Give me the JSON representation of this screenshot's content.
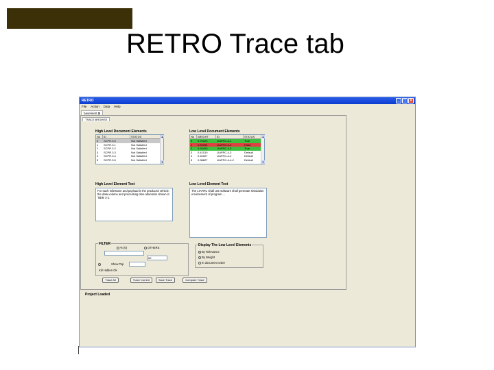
{
  "slide": {
    "title": "RETRO Trace tab",
    "accent_color": "#3b3008"
  },
  "window": {
    "title": "RETRO",
    "controls": [
      "_",
      "□",
      "X"
    ],
    "menu": [
      "File",
      "Action",
      "Data",
      "Help"
    ],
    "file_tab": "baseline0 ⊠",
    "inner_tab": "TRACE  BROWSE"
  },
  "high_level": {
    "title": "High Level Document Elements",
    "columns": [
      "No",
      "ID",
      "STATUS"
    ],
    "rows": [
      {
        "no": "0",
        "id": "SCPR.3.0",
        "status": "Not Satisfied"
      },
      {
        "no": "1",
        "id": "SCPR.3.1",
        "status": "Not Satisfied"
      },
      {
        "no": "2",
        "id": "SCPR.3.2",
        "status": "Not Satisfied"
      },
      {
        "no": "3",
        "id": "SCPR.3.3",
        "status": "Not Satisfied"
      },
      {
        "no": "4",
        "id": "SCPR.3.4",
        "status": "Not Satisfied"
      },
      {
        "no": "5",
        "id": "SCPR.3.5",
        "status": "Not Satisfied"
      }
    ]
  },
  "low_level": {
    "title": "Low Level Document Elements",
    "columns": [
      "No",
      "WEIGHT",
      "ID",
      "STATUS"
    ],
    "rows": [
      {
        "no": "0",
        "weight": "0.70125",
        "id": "LIAFRC-4-1",
        "status": "True",
        "color": "#3fbf3f"
      },
      {
        "no": "1",
        "weight": "0.69254",
        "id": "LIAFRC-4-2",
        "status": "False",
        "color": "#e04040"
      },
      {
        "no": "2",
        "weight": "0.53420",
        "id": "LIAFRC-4-3",
        "status": "True",
        "color": "#3fbf3f"
      },
      {
        "no": "3",
        "weight": "0.41010",
        "id": "LIAFRC-4-3",
        "status": "Default",
        "color": ""
      },
      {
        "no": "4",
        "weight": "0.40027",
        "id": "LIAFRC-4-2",
        "status": "Default",
        "color": ""
      },
      {
        "no": "5",
        "weight": "0.38827",
        "id": "LIAFRC-4-4-2",
        "status": "Default",
        "color": ""
      }
    ]
  },
  "high_text": {
    "title": "High Level Element Text",
    "content": "For each milestone and payload in the produced vehicle, the data volume and processing time allocation shown in Table 3-1."
  },
  "low_text": {
    "title": "Low Level Element Text",
    "content": "The LIAFRC shall use software shall generate simulation environment of program ..."
  },
  "filter": {
    "title": "FILTER",
    "opt_percent": "% (0)",
    "opt_other": "OTHERS",
    "value_field": "60",
    "show_top": "Show Top",
    "hidden_label": "Kill Hidden",
    "hidden_value": "Ok"
  },
  "display": {
    "title": "Display The Low Level Elements",
    "options": [
      "By Relevance",
      "By Weight",
      "In document order"
    ]
  },
  "buttons": {
    "trace_all": "Trace All",
    "trace_current": "Trace Current",
    "save_trace": "Save Trace",
    "compare_trace": "Compare Trace"
  },
  "status_text": "Project Loaded"
}
